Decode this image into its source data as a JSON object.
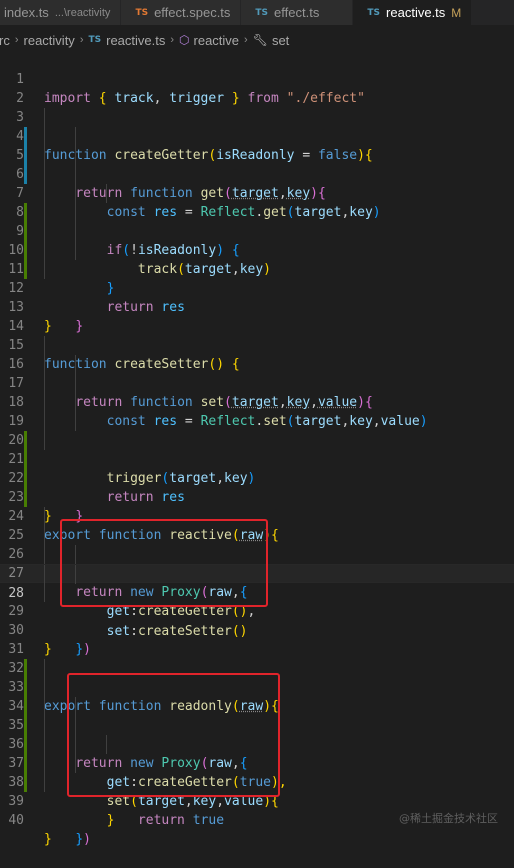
{
  "tabs": [
    {
      "icon": "",
      "label": "index.ts",
      "hint": "...\\reactivity",
      "active": false
    },
    {
      "icon": "TS",
      "label": "effect.spec.ts",
      "active": false
    },
    {
      "icon": "TS",
      "label": "effect.ts",
      "active": false
    },
    {
      "icon": "TS",
      "label": "reactive.ts",
      "modified": "M",
      "active": true
    }
  ],
  "breadcrumb": {
    "root": "rc",
    "folder": "reactivity",
    "file_icon": "TS",
    "file": "reactive.ts",
    "symbol1": "reactive",
    "symbol2": "set"
  },
  "code": {
    "line_numbers": [
      "1",
      "2",
      "3",
      "4",
      "5",
      "6",
      "7",
      "8",
      "9",
      "10",
      "11",
      "12",
      "13",
      "14",
      "15",
      "16",
      "17",
      "18",
      "19",
      "20",
      "21",
      "22",
      "23",
      "24",
      "25",
      "26",
      "27",
      "28",
      "29",
      "30",
      "31",
      "32",
      "33",
      "34",
      "35",
      "36",
      "37",
      "38",
      "39",
      "40"
    ],
    "l1": {
      "t1": "import",
      "t2": "{",
      "t3": "track",
      "t4": ",",
      "t5": "trigger",
      "t6": "}",
      "t7": "from",
      "t8": "\"./effect\""
    },
    "l3": {
      "t1": "function",
      "t2": "createGetter",
      "t3": "(",
      "t4": "isReadonly",
      "t5": "=",
      "t6": "false",
      "t7": "){"
    },
    "l4": {
      "t1": "return",
      "t2": "function",
      "t3": "get",
      "t4": "(",
      "t5": "target",
      "t6": ",",
      "t7": "key",
      "t8": "){"
    },
    "l5": {
      "t1": "const",
      "t2": "res",
      "t3": "=",
      "t4": "Reflect",
      "t5": ".",
      "t6": "get",
      "t7": "(",
      "t8": "target",
      "t9": ",",
      "t10": "key",
      "t11": ")"
    },
    "l7": {
      "t1": "if",
      "t2": "(",
      "t3": "!",
      "t4": "isReadonly",
      "t5": ")",
      "t6": "{"
    },
    "l8": {
      "t1": "track",
      "t2": "(",
      "t3": "target",
      "t4": ",",
      "t5": "key",
      "t6": ")"
    },
    "l9": {
      "t1": "}"
    },
    "l11": {
      "t1": "return",
      "t2": "res"
    },
    "l12": {
      "t1": "}"
    },
    "l13": {
      "t1": "}"
    },
    "l15": {
      "t1": "function",
      "t2": "createSetter",
      "t3": "()",
      "t4": "{"
    },
    "l16": {
      "t1": "return",
      "t2": "function",
      "t3": "set",
      "t4": "(",
      "t5": "target",
      "t6": ",",
      "t7": "key",
      "t8": ",",
      "t9": "value",
      "t10": "){"
    },
    "l17": {
      "t1": "const",
      "t2": "res",
      "t3": "=",
      "t4": "Reflect",
      "t5": ".",
      "t6": "set",
      "t7": "(",
      "t8": "target",
      "t9": ",",
      "t10": "key",
      "t11": ",",
      "t12": "value",
      "t13": ")"
    },
    "l19": {
      "t1": "trigger",
      "t2": "(",
      "t3": "target",
      "t4": ",",
      "t5": "key",
      "t6": ")"
    },
    "l20": {
      "t1": "return",
      "t2": "res"
    },
    "l21": {
      "t1": "}"
    },
    "l22": {
      "t1": "}"
    },
    "l24": {
      "t1": "export",
      "t2": "function",
      "t3": "reactive",
      "t4": "(",
      "t5": "raw",
      "t6": "){"
    },
    "l26": {
      "t1": "return",
      "t2": "new",
      "t3": "Proxy",
      "t4": "(",
      "t5": "raw",
      "t6": ",",
      "t7": "{"
    },
    "l27": {
      "t1": "get",
      "t2": ":",
      "t3": "createGetter",
      "t4": "()",
      "t5": ","
    },
    "l28": {
      "t1": "set",
      "t2": ":",
      "t3": "createSetter",
      "t4": "()"
    },
    "l29": {
      "t1": "}",
      "t2": ")"
    },
    "l30": {
      "t1": "}"
    },
    "l32": {
      "t1": "export",
      "t2": "function",
      "t3": "readonly",
      "t4": "(",
      "t5": "raw",
      "t6": "){"
    },
    "l34": {
      "t1": "return",
      "t2": "new",
      "t3": "Proxy",
      "t4": "(",
      "t5": "raw",
      "t6": ",",
      "t7": "{"
    },
    "l35": {
      "t1": "get",
      "t2": ":",
      "t3": "createGetter",
      "t4": "(",
      "t5": "true",
      "t6": "),"
    },
    "l36": {
      "t1": "set",
      "t2": "(",
      "t3": "target",
      "t4": ",",
      "t5": "key",
      "t6": ",",
      "t7": "value",
      "t8": "){"
    },
    "l37": {
      "t1": "return",
      "t2": "true"
    },
    "l38": {
      "t1": "}"
    },
    "l39": {
      "t1": "}",
      "t2": ")"
    },
    "l40": {
      "t1": "}"
    }
  },
  "watermark": "@稀土掘金技术社区",
  "colors": {
    "editor_bg": "#1e1e1e",
    "highlight_box": "#e0242b",
    "ts_icon": "#519aba"
  }
}
